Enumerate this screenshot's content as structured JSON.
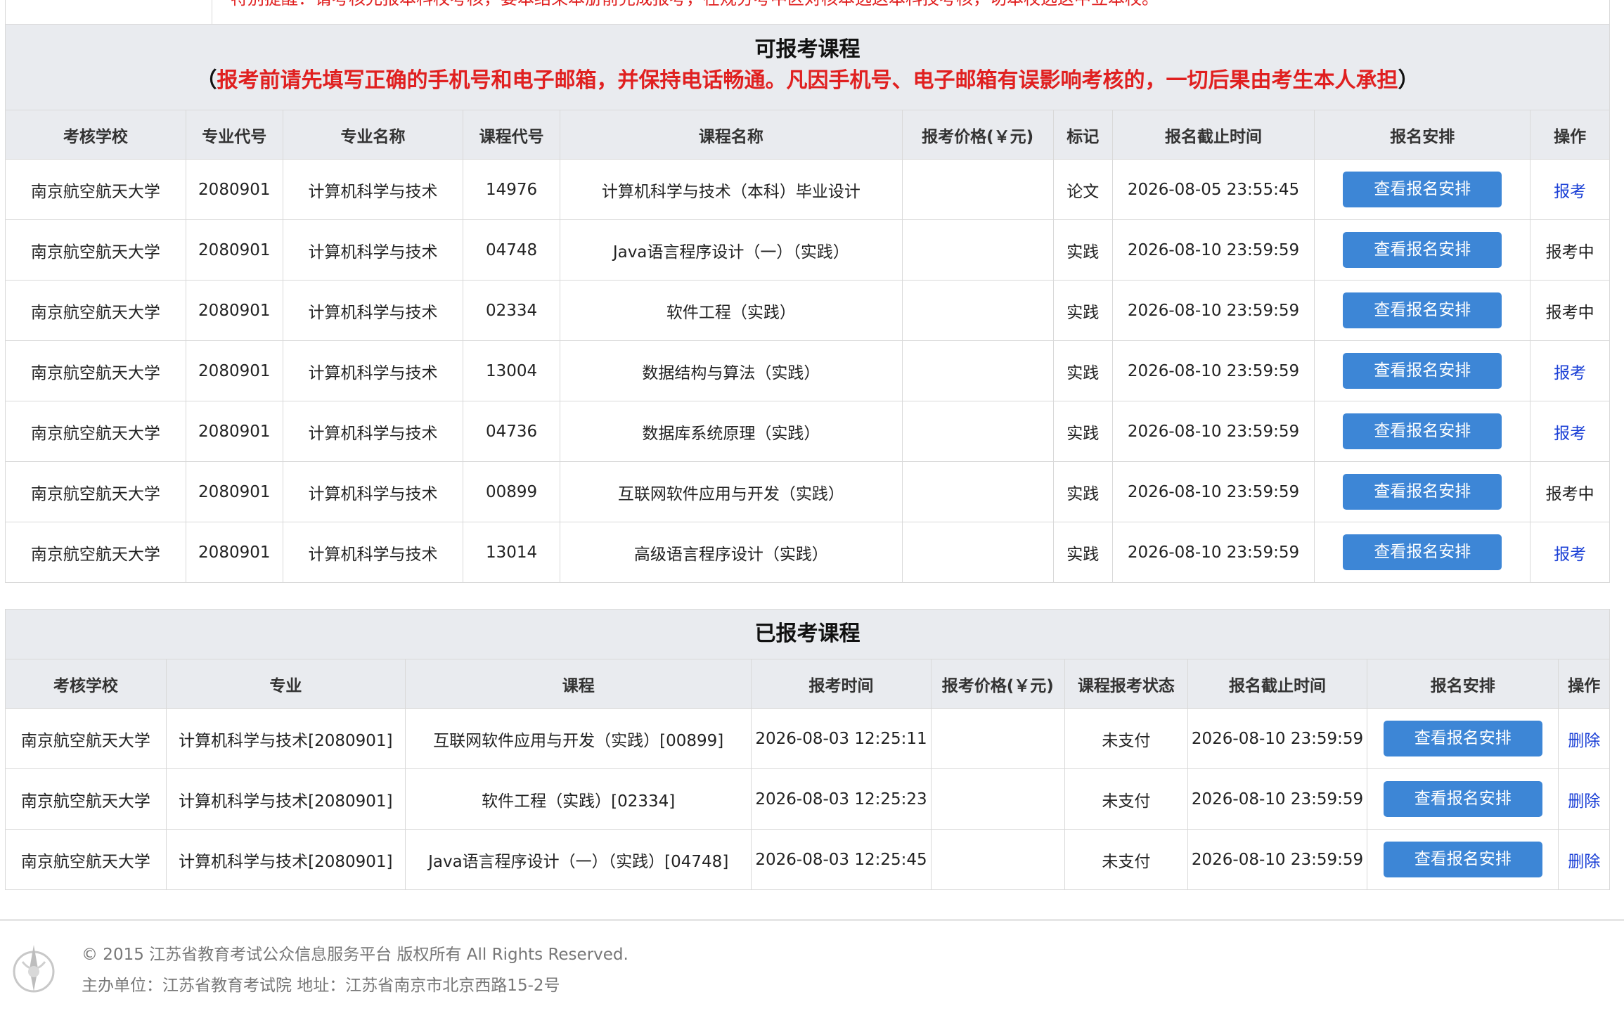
{
  "top_notice": "特别提醒：请考核允报本科校考核，要本结束本册前完成报考，在规分考中区对核本选这本科技考核，切本校选这中立本校。",
  "available": {
    "title": "可报考课程",
    "note_open": "（",
    "note": "报考前请先填写正确的手机号和电子邮箱，并保持电话畅通。凡因手机号、电子邮箱有误影响考核的，一切后果由考生本人承担",
    "note_close": "）",
    "columns": [
      "考核学校",
      "专业代号",
      "专业名称",
      "课程代号",
      "课程名称",
      "报考价格(￥元)",
      "标记",
      "报名截止时间",
      "报名安排",
      "操作"
    ],
    "rows": [
      {
        "school": "南京航空航天大学",
        "major_code": "2080901",
        "major": "计算机科学与技术",
        "course_code": "14976",
        "course": "计算机科学与技术（本科）毕业设计",
        "price": "",
        "mark": "论文",
        "deadline": "2026-08-05 23:55:45",
        "arrange": "查看报名安排",
        "action": "报考"
      },
      {
        "school": "南京航空航天大学",
        "major_code": "2080901",
        "major": "计算机科学与技术",
        "course_code": "04748",
        "course": "Java语言程序设计（一）（实践）",
        "price": "",
        "mark": "实践",
        "deadline": "2026-08-10 23:59:59",
        "arrange": "查看报名安排",
        "action": "报考中"
      },
      {
        "school": "南京航空航天大学",
        "major_code": "2080901",
        "major": "计算机科学与技术",
        "course_code": "02334",
        "course": "软件工程（实践）",
        "price": "",
        "mark": "实践",
        "deadline": "2026-08-10 23:59:59",
        "arrange": "查看报名安排",
        "action": "报考中"
      },
      {
        "school": "南京航空航天大学",
        "major_code": "2080901",
        "major": "计算机科学与技术",
        "course_code": "13004",
        "course": "数据结构与算法（实践）",
        "price": "",
        "mark": "实践",
        "deadline": "2026-08-10 23:59:59",
        "arrange": "查看报名安排",
        "action": "报考"
      },
      {
        "school": "南京航空航天大学",
        "major_code": "2080901",
        "major": "计算机科学与技术",
        "course_code": "04736",
        "course": "数据库系统原理（实践）",
        "price": "",
        "mark": "实践",
        "deadline": "2026-08-10 23:59:59",
        "arrange": "查看报名安排",
        "action": "报考"
      },
      {
        "school": "南京航空航天大学",
        "major_code": "2080901",
        "major": "计算机科学与技术",
        "course_code": "00899",
        "course": "互联网软件应用与开发（实践）",
        "price": "",
        "mark": "实践",
        "deadline": "2026-08-10 23:59:59",
        "arrange": "查看报名安排",
        "action": "报考中"
      },
      {
        "school": "南京航空航天大学",
        "major_code": "2080901",
        "major": "计算机科学与技术",
        "course_code": "13014",
        "course": "高级语言程序设计（实践）",
        "price": "",
        "mark": "实践",
        "deadline": "2026-08-10 23:59:59",
        "arrange": "查看报名安排",
        "action": "报考"
      }
    ]
  },
  "registered": {
    "title": "已报考课程",
    "columns": [
      "考核学校",
      "专业",
      "课程",
      "报考时间",
      "报考价格(￥元)",
      "课程报考状态",
      "报名截止时间",
      "报名安排",
      "操作"
    ],
    "rows": [
      {
        "school": "南京航空航天大学",
        "major": "计算机科学与技术[2080901]",
        "course": "互联网软件应用与开发（实践）[00899]",
        "time": "2026-08-03 12:25:11",
        "price": "",
        "status": "未支付",
        "deadline": "2026-08-10 23:59:59",
        "arrange": "查看报名安排",
        "action": "删除"
      },
      {
        "school": "南京航空航天大学",
        "major": "计算机科学与技术[2080901]",
        "course": "软件工程（实践）[02334]",
        "time": "2026-08-03 12:25:23",
        "price": "",
        "status": "未支付",
        "deadline": "2026-08-10 23:59:59",
        "arrange": "查看报名安排",
        "action": "删除"
      },
      {
        "school": "南京航空航天大学",
        "major": "计算机科学与技术[2080901]",
        "course": "Java语言程序设计（一）（实践）[04748]",
        "time": "2026-08-03 12:25:45",
        "price": "",
        "status": "未支付",
        "deadline": "2026-08-10 23:59:59",
        "arrange": "查看报名安排",
        "action": "删除"
      }
    ]
  },
  "footer": {
    "copyright": "© 2015 江苏省教育考试公众信息服务平台 版权所有 All Rights Reserved.",
    "address": "主办单位：江苏省教育考试院 地址：江苏省南京市北京西路15-2号"
  },
  "colors": {
    "accent": "#3d86d6",
    "warning": "#e02020",
    "link": "#1a3fd6"
  },
  "icons": {
    "footer_logo": "exam-authority-emblem-icon"
  }
}
